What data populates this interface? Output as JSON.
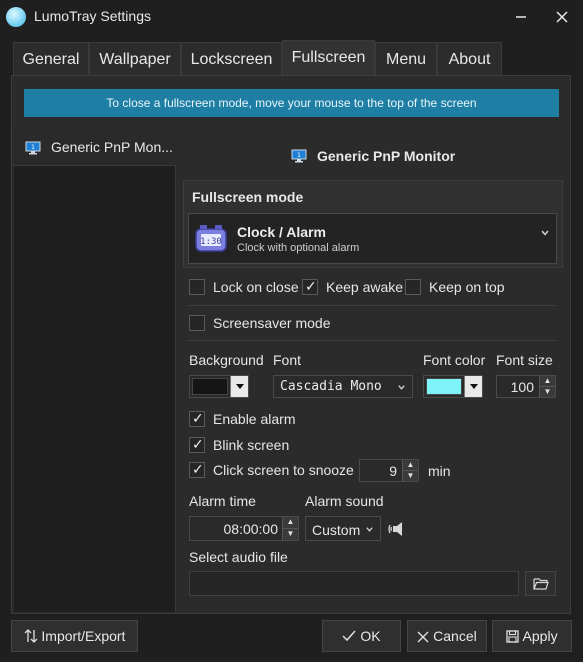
{
  "window": {
    "title": "LumoTray Settings"
  },
  "tabs": [
    {
      "label": "General"
    },
    {
      "label": "Wallpaper"
    },
    {
      "label": "Lockscreen"
    },
    {
      "label": "Fullscreen"
    },
    {
      "label": "Menu"
    },
    {
      "label": "About"
    }
  ],
  "active_tab": "Fullscreen",
  "info_banner": "To close a fullscreen mode, move your mouse to the top of the screen",
  "monitors": [
    {
      "label": "Generic PnP Mon..."
    }
  ],
  "selected_monitor_title": "Generic PnP Monitor",
  "fullscreen_mode": {
    "group_label": "Fullscreen mode",
    "selected_title": "Clock / Alarm",
    "selected_subtitle": "Clock with optional alarm",
    "clock_icon_text": "1:30"
  },
  "options": {
    "lock_on_close": {
      "label": "Lock on close",
      "checked": false
    },
    "keep_awake": {
      "label": "Keep awake",
      "checked": true
    },
    "keep_on_top": {
      "label": "Keep on top",
      "checked": false
    },
    "screensaver_mode": {
      "label": "Screensaver mode",
      "checked": false
    }
  },
  "appearance": {
    "background_label": "Background",
    "background_color": "#151515",
    "font_label": "Font",
    "font_value": "Cascadia Mono",
    "font_color_label": "Font color",
    "font_color": "#7ef4f8",
    "font_size_label": "Font size",
    "font_size_value": "100"
  },
  "alarm": {
    "enable_alarm": {
      "label": "Enable alarm",
      "checked": true
    },
    "blink_screen": {
      "label": "Blink screen",
      "checked": true
    },
    "click_to_snooze": {
      "label": "Click screen to snooze",
      "checked": true
    },
    "snooze_value": "9",
    "snooze_unit": "min",
    "alarm_time_label": "Alarm time",
    "alarm_time_value": "08:00:00",
    "alarm_sound_label": "Alarm sound",
    "alarm_sound_value": "Custom",
    "select_audio_label": "Select audio file",
    "audio_file_value": ""
  },
  "buttons": {
    "import_export": "Import/Export",
    "ok": "OK",
    "cancel": "Cancel",
    "apply": "Apply"
  },
  "colors": {
    "accent_banner": "#1f7ea3",
    "window_bg": "#1f1f1f"
  }
}
